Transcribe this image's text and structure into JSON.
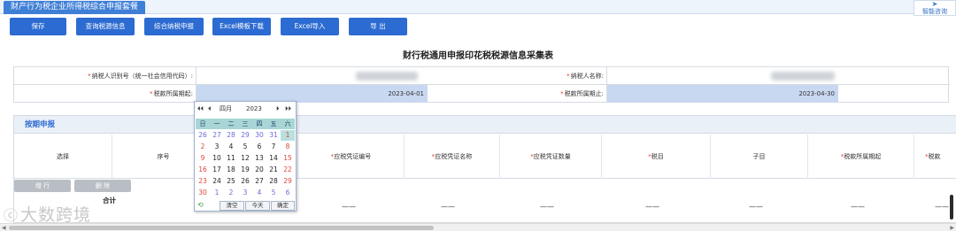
{
  "top_tab": "财产行为税企业所得税综合申报套餐",
  "smart_consult": {
    "icon": "chat-icon",
    "label": "智能咨询"
  },
  "toolbar": [
    "保存",
    "查询税源信息",
    "综合纳税申报",
    "Excel模板下载",
    "Excel导入",
    "导 出"
  ],
  "form_title": "财行税通用申报印花税税源信息采集表",
  "info": {
    "taxpayer_id_label": "纳税人识别号（统一社会信用代码）:",
    "taxpayer_name_label": "纳税人名称:",
    "period_start_label": "税款所属期起:",
    "period_start_value": "2023-04-01",
    "period_end_label": "税款所属期止:",
    "period_end_value": "2023-04-30"
  },
  "section": {
    "title": "按期申报",
    "columns": [
      {
        "label": "选择",
        "required": false
      },
      {
        "label": "序号",
        "required": false
      },
      {
        "label": "应税凭证编号",
        "required": true
      },
      {
        "label": "应税凭证名称",
        "required": true
      },
      {
        "label": "应税凭证数量",
        "required": true
      },
      {
        "label": "税目",
        "required": true
      },
      {
        "label": "子目",
        "required": false
      },
      {
        "label": "税款所属期起",
        "required": true
      },
      {
        "label": "税款",
        "required": true
      }
    ],
    "add_row": "增 行",
    "delete_row": "删 除",
    "total_label": "合计",
    "total_dash": "——"
  },
  "datepicker": {
    "nav_first": "⏴⏴",
    "nav_prev": "⏴",
    "month": "四月",
    "year": "2023",
    "nav_next": "⏵",
    "nav_last": "⏵⏵",
    "weekdays": [
      "日",
      "一",
      "二",
      "三",
      "四",
      "五",
      "六"
    ],
    "days": [
      [
        "26",
        "27",
        "28",
        "29",
        "30",
        "31",
        "1"
      ],
      [
        "2",
        "3",
        "4",
        "5",
        "6",
        "7",
        "8"
      ],
      [
        "9",
        "10",
        "11",
        "12",
        "13",
        "14",
        "15"
      ],
      [
        "16",
        "17",
        "18",
        "19",
        "20",
        "21",
        "22"
      ],
      [
        "23",
        "24",
        "25",
        "26",
        "27",
        "28",
        "29"
      ],
      [
        "30",
        "1",
        "2",
        "3",
        "4",
        "5",
        "6"
      ]
    ],
    "clear": "清空",
    "today": "今天",
    "confirm": "确定"
  },
  "watermark": "大数跨境",
  "colors": {
    "accent": "#2c6bd1",
    "header_band": "#eaf0f8",
    "date_field": "#c9d8f1",
    "required": "#e23a2e",
    "calendar_week": "#a8d6d6"
  }
}
